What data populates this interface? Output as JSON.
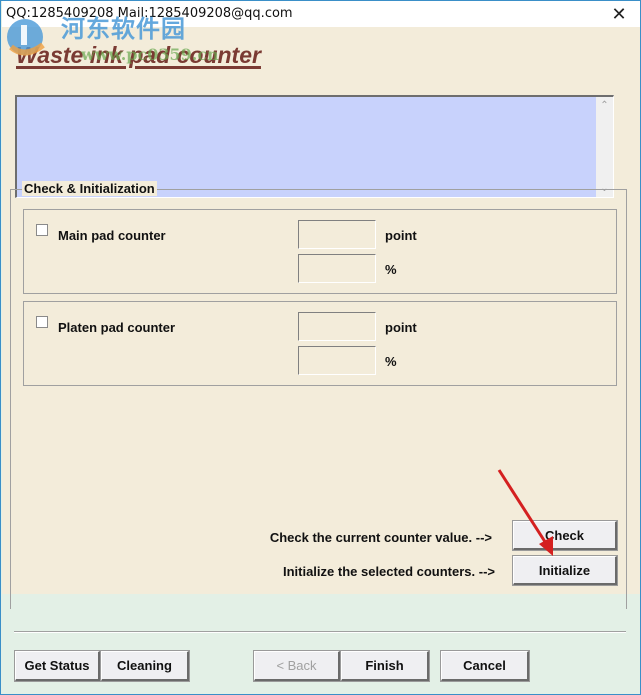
{
  "window": {
    "title": "QQ:1285409208 Mail:1285409208@qq.com",
    "close_icon": "close-icon"
  },
  "watermark": {
    "site_name": "河东软件园",
    "url": "www.pc0359.cn"
  },
  "page": {
    "heading": "Waste ink pad counter",
    "info_box_text": ""
  },
  "group": {
    "legend": "Check & Initialization",
    "counters": [
      {
        "label": "Main pad counter",
        "checked": false,
        "point_value": "",
        "percent_value": "",
        "point_unit": "point",
        "percent_unit": "%"
      },
      {
        "label": "Platen pad counter",
        "checked": false,
        "point_value": "",
        "percent_value": "",
        "point_unit": "point",
        "percent_unit": "%"
      }
    ],
    "check_hint": "Check the current counter value. -->",
    "init_hint": "Initialize the selected counters. -->",
    "check_button": "Check",
    "initialize_button": "Initialize"
  },
  "footer": {
    "get_status": "Get Status",
    "cleaning": "Cleaning",
    "back": "< Back",
    "finish": "Finish",
    "cancel": "Cancel"
  },
  "colors": {
    "heading": "#7a3a33",
    "info_box": "#c8d2fc",
    "panel_bg": "#f3ecda",
    "window_bg": "#e3f0e6",
    "annotation_arrow": "#d42020"
  }
}
